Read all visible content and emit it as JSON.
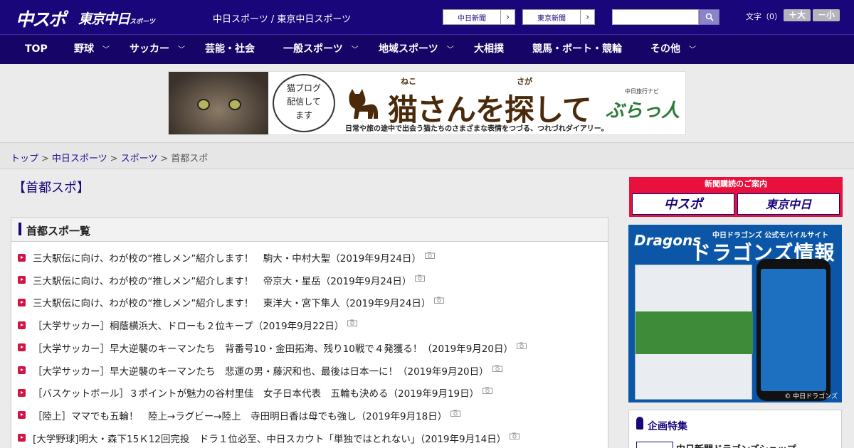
{
  "header": {
    "logo_chuspo": "中スポ",
    "logo_tokyo": "東京中日",
    "logo_tokyo_small": "スポーツ",
    "title": "中日スポーツ / 東京中日スポーツ",
    "link_chunichi": "中日新聞",
    "link_tokyo": "東京新聞",
    "search_value": "",
    "font_label": "文字（0）",
    "font_bigger": "＋大",
    "font_smaller": "－小"
  },
  "nav": [
    {
      "label": "TOP",
      "has_menu": false
    },
    {
      "label": "野球",
      "has_menu": true
    },
    {
      "label": "サッカー",
      "has_menu": true
    },
    {
      "label": "芸能・社会",
      "has_menu": false
    },
    {
      "label": "一般スポーツ",
      "has_menu": true
    },
    {
      "label": "地域スポーツ",
      "has_menu": true
    },
    {
      "label": "大相撲",
      "has_menu": false
    },
    {
      "label": "競馬・ボート・競輪",
      "has_menu": false
    },
    {
      "label": "その他",
      "has_menu": true
    }
  ],
  "banner": {
    "bubble_line1": "猫ブログ",
    "bubble_line2": "配信して",
    "bubble_line3": "ます",
    "title": "猫さんを探して",
    "ruby_neko": "ねこ",
    "ruby_saga": "さが",
    "brand_top": "中日旅行ナビ",
    "brand": "ぶらっ人",
    "subtitle": "日常や旅の途中で出会う猫たちのさまざまな表情をつづる、つれづれダイアリー。"
  },
  "breadcrumb": {
    "top": "トップ",
    "chunichi_sports": "中日スポーツ",
    "sports": "スポーツ",
    "current": "首都スポ",
    "sep": ">"
  },
  "page_title": "【首都スポ】",
  "list": {
    "heading": "首都スポ一覧",
    "items": [
      "三大駅伝に向け、わが校の“推しメン”紹介します！　駒大・中村大聖（2019年9月24日）",
      "三大駅伝に向け、わが校の“推しメン”紹介します！　帝京大・星岳（2019年9月24日）",
      "三大駅伝に向け、わが校の“推しメン”紹介します！　東洋大・宮下隼人（2019年9月24日）",
      "［大学サッカー］桐蔭横浜大、ドローも２位キープ（2019年9月22日）",
      "［大学サッカー］早大逆襲のキーマンたち　背番号10・金田拓海、残り10戦で４発獲る！（2019年9月20日）",
      "［大学サッカー］早大逆襲のキーマンたち　悲運の男・藤沢和也、最後は日本一に！（2019年9月20日）",
      "［バスケットボール］３ポイントが魅力の谷村里佳　女子日本代表　五輪も決める（2019年9月19日）",
      "［陸上］ママでも五輪！　陸上→ラグビー→陸上　寺田明日香は母でも強し（2019年9月18日）",
      "[大学野球]明大・森下15Ｋ12回完投　ドラ１位必至、中日スカウト「単独ではとれない」（2019年9月14日）"
    ]
  },
  "sidebar": {
    "subscribe_head": "新聞購読のご案内",
    "subscribe_chuspo": "中スポ",
    "subscribe_tokyo": "東京中日",
    "dragons_logo": "Dragons",
    "dragons_sub": "中日ドラゴンズ 公式モバイルサイト",
    "dragons_title": "ドラゴンズ情報",
    "dragons_copy": "© 中日ドラゴンズ",
    "feature_title": "企画特集",
    "feature_item": "中日新聞ドラゴンズショップ"
  },
  "colors": {
    "header_bg": "#18067a",
    "accent_red": "#d01445"
  }
}
